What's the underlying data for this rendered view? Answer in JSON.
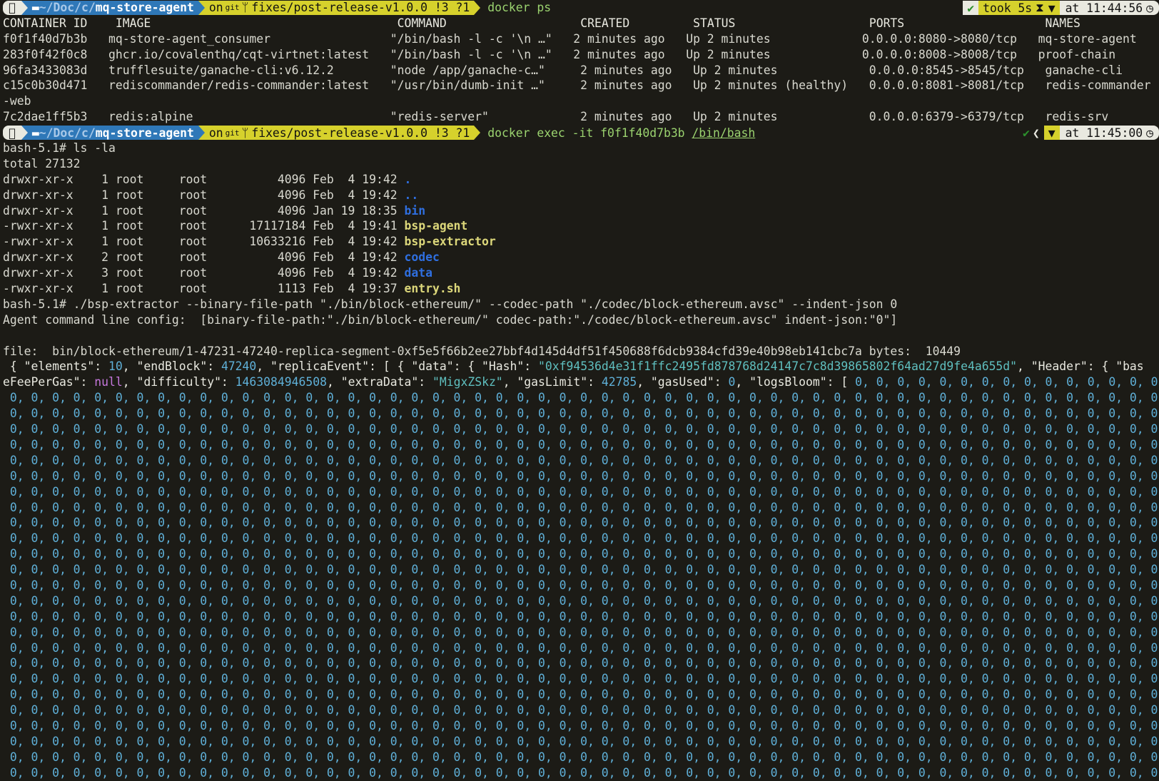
{
  "prompt1": {
    "path_home": "~/Doc/c/",
    "path_repo": "mq-store-agent",
    "git_on": "on",
    "git_branch": "fixes/post-release-v1.0.0 !3 ?1",
    "command": "docker ps",
    "status_ok": "✔",
    "took": "took 5s",
    "time": "at 11:44:56"
  },
  "docker_ps": {
    "headers": [
      "CONTAINER ID",
      "IMAGE",
      "COMMAND",
      "CREATED",
      "STATUS",
      "PORTS",
      "NAMES"
    ],
    "rows": [
      "f0f1f40d7b3b   mq-store-agent_consumer                 \"/bin/bash -l -c '\\n …\"   2 minutes ago   Up 2 minutes             0.0.0.0:8080->8080/tcp   mq-store-agent",
      "283f0f42f0c8   ghcr.io/covalenthq/cqt-virtnet:latest   \"/bin/bash -l -c '\\n …\"   2 minutes ago   Up 2 minutes             0.0.0.0:8008->8008/tcp   proof-chain",
      "96fa3433083d   trufflesuite/ganache-cli:v6.12.2        \"node /app/ganache-c…\"     2 minutes ago   Up 2 minutes             0.0.0.0:8545->8545/tcp   ganache-cli",
      "c15c0b30d471   rediscommander/redis-commander:latest   \"/usr/bin/dumb-init …\"     2 minutes ago   Up 2 minutes (healthy)   0.0.0.0:8081->8081/tcp   redis-commander",
      "-web",
      "7c2dae1ff5b3   redis:alpine                            \"redis-server\"             2 minutes ago   Up 2 minutes             0.0.0.0:6379->6379/tcp   redis-srv"
    ]
  },
  "prompt2": {
    "path_home": "~/Doc/c/",
    "path_repo": "mq-store-agent",
    "git_on": "on",
    "git_branch": "fixes/post-release-v1.0.0 !3 ?1",
    "command_pre": "docker exec -it f0f1f40d7b3b ",
    "command_arg": "/bin/bash",
    "status_ok": "✔",
    "time": "at 11:45:00"
  },
  "shell": {
    "ls_cmd": "bash-5.1# ls -la",
    "total": "total 27132",
    "entries": [
      {
        "meta": "drwxr-xr-x    1 root     root          4096 Feb  4 19:42 ",
        "name": ".",
        "kind": "dir"
      },
      {
        "meta": "drwxr-xr-x    1 root     root          4096 Feb  4 19:42 ",
        "name": "..",
        "kind": "dir"
      },
      {
        "meta": "drwxr-xr-x    1 root     root          4096 Jan 19 18:35 ",
        "name": "bin",
        "kind": "dir"
      },
      {
        "meta": "-rwxr-xr-x    1 root     root      17117184 Feb  4 19:41 ",
        "name": "bsp-agent",
        "kind": "exe"
      },
      {
        "meta": "-rwxr-xr-x    1 root     root      10633216 Feb  4 19:42 ",
        "name": "bsp-extractor",
        "kind": "exe"
      },
      {
        "meta": "drwxr-xr-x    2 root     root          4096 Feb  4 19:42 ",
        "name": "codec",
        "kind": "dir"
      },
      {
        "meta": "drwxr-xr-x    3 root     root          4096 Feb  4 19:42 ",
        "name": "data",
        "kind": "dir"
      },
      {
        "meta": "-rwxr-xr-x    1 root     root          1113 Feb  4 19:37 ",
        "name": "entry.sh",
        "kind": "exe"
      }
    ],
    "extract_cmd": "bash-5.1# ./bsp-extractor --binary-file-path \"./bin/block-ethereum/\" --codec-path \"./codec/block-ethereum.avsc\" --indent-json 0",
    "agent_config": "Agent command line config:  [binary-file-path:\"./bin/block-ethereum/\" codec-path:\"./codec/block-ethereum.avsc\" indent-json:\"0\"]",
    "file_line": "file:  bin/block-ethereum/1-47231-47240-replica-segment-0xf5e5f66b2ee27bbf4d145d4df51f450688f6dcb9384cfd39e40b98eb141cbc7a bytes:  10449"
  },
  "json_output": [
    [
      [
        "k",
        " { \"elements\": "
      ],
      [
        "n",
        "10"
      ],
      [
        "k",
        ", \"endBlock\": "
      ],
      [
        "n",
        "47240"
      ],
      [
        "k",
        ", \"replicaEvent\": [ { \"data\": { \"Hash\": "
      ],
      [
        "s",
        "\"0xf94536d4e31f1ffc2495fd878768d24147c7c8d39865802f64ad27d9fe4a655d\""
      ],
      [
        "k",
        ", \"Header\": { \"bas"
      ]
    ],
    [
      [
        "k",
        "eFeePerGas\": "
      ],
      [
        "u",
        "null"
      ],
      [
        "k",
        ", \"difficulty\": "
      ],
      [
        "n",
        "1463084946508"
      ],
      [
        "k",
        ", \"extraData\": "
      ],
      [
        "s",
        "\"MigxZSkz\""
      ],
      [
        "k",
        ", \"gasLimit\": "
      ],
      [
        "n",
        "42785"
      ],
      [
        "k",
        ", \"gasUsed\": "
      ],
      [
        "n",
        "0"
      ],
      [
        "k",
        ", \"logsBloom\": [ "
      ],
      [
        "n",
        "0, 0, 0, 0, 0, 0, 0, 0, 0, 0, 0, 0, 0, 0, 0, 0, 0,"
      ]
    ],
    [
      [
        "n",
        " 0, 0, 0, 0, 0, 0, 0, 0, 0, 0, 0, 0, 0, 0, 0, 0, 0, 0, 0, 0, 0, 0, 0, 0, 0, 0, 0, 0, 0, 0, 0, 0, 0, 0, 0, 0, 0, 0, 0, 0, 0, 0, 0, 0, 0, 0, 0, 0, 0, 0, 0, 0, 0, 0, 0, 0, 0, 0, 0, 0,"
      ]
    ],
    [
      [
        "n",
        " 0, 0, 0, 0, 0, 0, 0, 0, 0, 0, 0, 0, 0, 0, 0, 0, 0, 0, 0, 0, 0, 0, 0, 0, 0, 0, 0, 0, 0, 0, 0, 0, 0, 0, 0, 0, 0, 0, 0, 0, 0, 0, 0, 0, 0, 0, 0, 0, 0, 0, 0, 0, 0, 0, 0, 0, 0, 0, 0, 0,"
      ]
    ],
    [
      [
        "n",
        " 0, 0, 0, 0, 0, 0, 0, 0, 0, 0, 0, 0, 0, 0, 0, 0, 0, 0, 0, 0, 0, 0, 0, 0, 0, 0, 0, 0, 0, 0, 0, 0, 0, 0, 0, 0, 0, 0, 0, 0, 0, 0, 0, 0, 0, 0, 0, 0, 0, 0, 0, 0, 0, 0, 0, 0, 0, 0, 0, 0,"
      ]
    ],
    [
      [
        "n",
        " 0, 0, 0, 0, 0, 0, 0, 0, 0, 0, 0, 0, 0, 0, 0, 0, 0, 0, 0, 0, 0, 0, 0, 0, 0, 0, 0, 0, 0, 0, 0, 0, 0, 0, 0, 0, 0, 0, 0, 0, 0, 0, 0, 0, 0, 0, 0, 0, 0, 0, 0, 0, 0, 0, 0, 0, 0, 0, 0, 0,"
      ]
    ],
    [
      [
        "n",
        " 0, 0, 0, 0, 0, 0, 0, 0, 0, 0, 0, 0, 0, 0, 0, 0, 0, 0, 0, 0, 0, 0, 0, 0, 0, 0, 0, 0, 0, 0, 0, 0, 0, 0, 0, 0, 0, 0, 0, 0, 0, 0, 0, 0, 0, 0, 0, 0, 0, 0, 0, 0, 0, 0, 0, 0, 0, 0, 0, 0,"
      ]
    ],
    [
      [
        "n",
        " 0, 0, 0, 0, 0, 0, 0, 0, 0, 0, 0, 0, 0, 0, 0, 0, 0, 0, 0, 0, 0, 0, 0, 0, 0, 0, 0, 0, 0, 0, 0, 0, 0, 0, 0, 0, 0, 0, 0, 0, 0, 0, 0, 0, 0, 0, 0, 0, 0, 0, 0, 0, 0, 0, 0, 0, 0, 0, 0, 0,"
      ]
    ],
    [
      [
        "n",
        " 0, 0, 0, 0, 0, 0, 0, 0, 0, 0, 0, 0, 0, 0, 0, 0, 0, 0, 0, 0, 0, 0, 0, 0, 0, 0, 0, 0, 0, 0, 0, 0, 0, 0, 0, 0, 0, 0, 0, 0, 0, 0, 0, 0, 0, 0, 0, 0, 0, 0, 0, 0, 0, 0, 0, 0, 0, 0, 0, 0,"
      ]
    ],
    [
      [
        "n",
        " 0, 0, 0, 0, 0, 0, 0, 0, 0, 0, 0, 0, 0, 0, 0, 0, 0, 0, 0, 0, 0, 0, 0, 0, 0, 0, 0, 0, 0, 0, 0, 0, 0, 0, 0, 0, 0, 0, 0, 0, 0, 0, 0, 0, 0, 0, 0, 0, 0, 0, 0, 0, 0, 0, 0, 0, 0, 0, 0, 0,"
      ]
    ],
    [
      [
        "n",
        " 0, 0, 0, 0, 0, 0, 0, 0, 0, 0, 0, 0, 0, 0, 0, 0, 0, 0, 0, 0, 0, 0, 0, 0, 0, 0, 0, 0, 0, 0, 0, 0, 0, 0, 0, 0, 0, 0, 0, 0, 0, 0, 0, 0, 0, 0, 0, 0, 0, 0, 0, 0, 0, 0, 0, 0, 0, 0, 0, 0,"
      ]
    ],
    [
      [
        "n",
        " 0, 0, 0, 0, 0, 0, 0, 0, 0, 0, 0, 0, 0, 0, 0, 0, 0, 0, 0, 0, 0, 0, 0, 0, 0, 0, 0, 0, 0, 0, 0, 0, 0, 0, 0, 0, 0, 0, 0, 0, 0, 0, 0, 0, 0, 0, 0, 0, 0, 0, 0, 0, 0, 0, 0, 0, 0, 0, 0, 0,"
      ]
    ],
    [
      [
        "n",
        " 0, 0, 0, 0, 0, 0, 0, 0, 0, 0, 0, 0, 0, 0, 0, 0, 0, 0, 0, 0, 0, 0, 0, 0, 0, 0, 0, 0, 0, 0, 0, 0, 0, 0, 0, 0, 0, 0, 0, 0, 0, 0, 0, 0, 0, 0, 0, 0, 0, 0, 0, 0, 0, 0, 0, 0, 0, 0, 0, 0,"
      ]
    ],
    [
      [
        "n",
        " 0, 0, 0, 0, 0, 0, 0, 0, 0, 0, 0, 0, 0, 0, 0, 0, 0, 0, 0, 0, 0, 0, 0, 0, 0, 0, 0, 0, 0, 0, 0, 0, 0, 0, 0, 0, 0, 0, 0, 0, 0, 0, 0, 0, 0, 0, 0, 0, 0, 0, 0, 0, 0, 0, 0, 0, 0, 0, 0, 0,"
      ]
    ],
    [
      [
        "n",
        " 0, 0, 0, 0, 0, 0, 0, 0, 0, 0, 0, 0, 0, 0, 0, 0, 0, 0, 0, 0, 0, 0, 0, 0, 0, 0, 0, 0, 0, 0, 0, 0, 0, 0, 0, 0, 0, 0, 0, 0, 0, 0, 0, 0, 0, 0, 0, 0, 0, 0, 0, 0, 0, 0, 0, 0, 0, 0, 0, 0,"
      ]
    ],
    [
      [
        "n",
        " 0, 0, 0, 0, 0, 0, 0, 0, 0, 0, 0, 0, 0, 0, 0, 0, 0, 0, 0, 0, 0, 0, 0, 0, 0, 0, 0, 0, 0, 0, 0, 0, 0, 0, 0, 0, 0, 0, 0, 0, 0, 0, 0, 0, 0, 0, 0, 0, 0, 0, 0, 0, 0, 0, 0, 0, 0, 0, 0, 0,"
      ]
    ],
    [
      [
        "n",
        " 0, 0, 0, 0, 0, 0, 0, 0, 0, 0, 0, 0, 0, 0, 0, 0, 0, 0, 0, 0, 0, 0, 0, 0, 0, 0, 0, 0, 0, 0, 0, 0, 0, 0, 0, 0, 0, 0, 0, 0, 0, 0, 0, 0, 0, 0, 0, 0, 0, 0, 0, 0, 0, 0, 0, 0, 0, 0, 0, 0,"
      ]
    ],
    [
      [
        "n",
        " 0, 0, 0, 0, 0, 0, 0, 0, 0, 0, 0, 0, 0, 0, 0, 0, 0, 0, 0, 0, 0, 0, 0, 0, 0, 0, 0, 0, 0, 0, 0, 0, 0, 0, 0, 0, 0, 0, 0, 0, 0, 0, 0, 0, 0, 0, 0, 0, 0, 0, 0, 0, 0, 0, 0, 0, 0, 0, 0, 0,"
      ]
    ],
    [
      [
        "n",
        " 0, 0, 0, 0, 0, 0, 0, 0, 0, 0, 0, 0, 0, 0, 0, 0, 0, 0, 0, 0, 0, 0, 0, 0, 0, 0, 0, 0, 0, 0, 0, 0, 0, 0, 0, 0, 0, 0, 0, 0, 0, 0, 0, 0, 0, 0, 0, 0, 0, 0, 0, 0, 0, 0, 0, 0, 0, 0, 0, 0,"
      ]
    ],
    [
      [
        "n",
        " 0, 0, 0, 0, 0, 0, 0, 0, 0, 0, 0, 0, 0, 0, 0, 0, 0, 0, 0, 0, 0, 0, 0, 0, 0, 0, 0, 0, 0, 0, 0, 0, 0, 0, 0, 0, 0, 0, 0, 0, 0, 0, 0, 0, 0, 0, 0, 0, 0, 0, 0, 0, 0, 0, 0, 0, 0, 0, 0, 0,"
      ]
    ],
    [
      [
        "n",
        " 0, 0, 0, 0, 0, 0, 0, 0, 0, 0, 0, 0, 0, 0, 0, 0, 0, 0, 0, 0, 0, 0, 0, 0, 0, 0, 0, 0, 0, 0, 0, 0, 0, 0, 0, 0, 0, 0, 0, 0, 0, 0, 0, 0, 0, 0, 0, 0, 0, 0, 0, 0, 0, 0, 0, 0, 0, 0, 0, 0,"
      ]
    ],
    [
      [
        "n",
        " 0, 0, 0, 0, 0, 0, 0, 0, 0, 0, 0, 0, 0, 0, 0, 0, 0, 0, 0, 0, 0, 0, 0, 0, 0, 0, 0, 0, 0, 0, 0, 0, 0, 0, 0, 0, 0, 0, 0, 0, 0, 0, 0, 0, 0, 0, 0, 0, 0, 0, 0, 0, 0, 0, 0, 0, 0, 0, 0, 0,"
      ]
    ],
    [
      [
        "n",
        " 0, 0, 0, 0, 0, 0, 0, 0, 0, 0, 0, 0, 0, 0, 0, 0, 0, 0, 0, 0, 0, 0, 0, 0, 0, 0, 0, 0, 0, 0, 0, 0, 0, 0, 0, 0, 0, 0, 0, 0, 0, 0, 0, 0, 0, 0, 0, 0, 0, 0, 0, 0, 0, 0, 0, 0, 0, 0, 0, 0,"
      ]
    ],
    [
      [
        "n",
        " 0, 0, 0, 0, 0, 0, 0, 0, 0, 0, 0, 0, 0, 0, 0, 0, 0, 0, 0, 0, 0, 0, 0, 0, 0, 0, 0, 0, 0, 0, 0, 0, 0, 0, 0, 0, 0, 0, 0, 0, 0, 0, 0, 0, 0, 0, 0, 0, 0, 0, 0, 0, 0, 0, 0, 0, 0, 0, 0, 0,"
      ]
    ],
    [
      [
        "n",
        " 0, 0, 0, 0, 0, 0, 0, 0, 0, 0, 0, 0, 0, 0, 0, 0, 0, 0, 0, 0, 0, 0, 0, 0, 0, 0, 0, 0, 0, 0, 0, 0, 0, 0, 0, 0, 0, 0, 0, 0, 0, 0, 0, 0, 0, 0, 0, 0, 0, 0, 0, 0, 0, 0, 0, 0, 0, 0, 0, 0,"
      ]
    ],
    [
      [
        "n",
        " 0, 0, 0, 0, 0, 0, 0, 0, 0, 0, 0, 0, 0, 0, 0, 0, 0, 0, 0, 0, 0, 0, 0, 0, 0, 0, 0, 0, 0, 0, 0, 0, 0, 0, 0, 0, 0, 0, 0, 0, 0, 0, 0, 0, 0, 0, 0, 0, 0, 0, 0, 0, 0, 0, 0, 0, 0, 0, 0, 0,"
      ]
    ],
    [
      [
        "n",
        " 0, 0, 0, 0, 0, 0, 0, 0, 0, 0, 0, 0, 0, 0, 0, 0, 0, 0, 0, 0, 0, 0, 0, 0, 0, 0, 0, 0, 0, 0, 0, 0, 0, 0, 0, 0, 0, 0, 0, 0, 0, 0, 0, 0, 0, 0, 0, 0, 0, 0, 0, 0, 0, 0, 0, 0, 0, 0, 0, 0,"
      ]
    ]
  ]
}
